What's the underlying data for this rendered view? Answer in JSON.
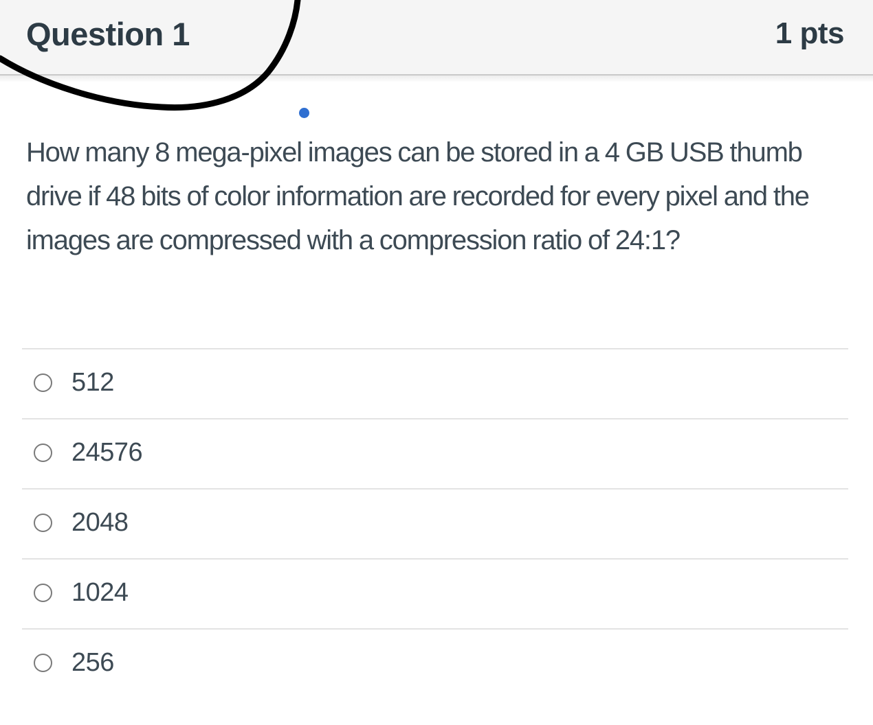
{
  "question": {
    "title": "Question 1",
    "points": "1 pts",
    "text": "How many 8 mega-pixel images can be stored in a 4 GB USB thumb drive if 48 bits of color information are recorded for every pixel and the images are compressed with a compression ratio of 24:1?"
  },
  "answers": [
    {
      "label": "512",
      "selected": false
    },
    {
      "label": "24576",
      "selected": false
    },
    {
      "label": "2048",
      "selected": false
    },
    {
      "label": "1024",
      "selected": false
    },
    {
      "label": "256",
      "selected": false
    }
  ],
  "colors": {
    "header_bg": "#f5f5f5",
    "text": "#3d4a54",
    "title_text": "#2d3b45",
    "cursor_dot": "#2f6fd1",
    "annotation_stroke": "#000000"
  }
}
